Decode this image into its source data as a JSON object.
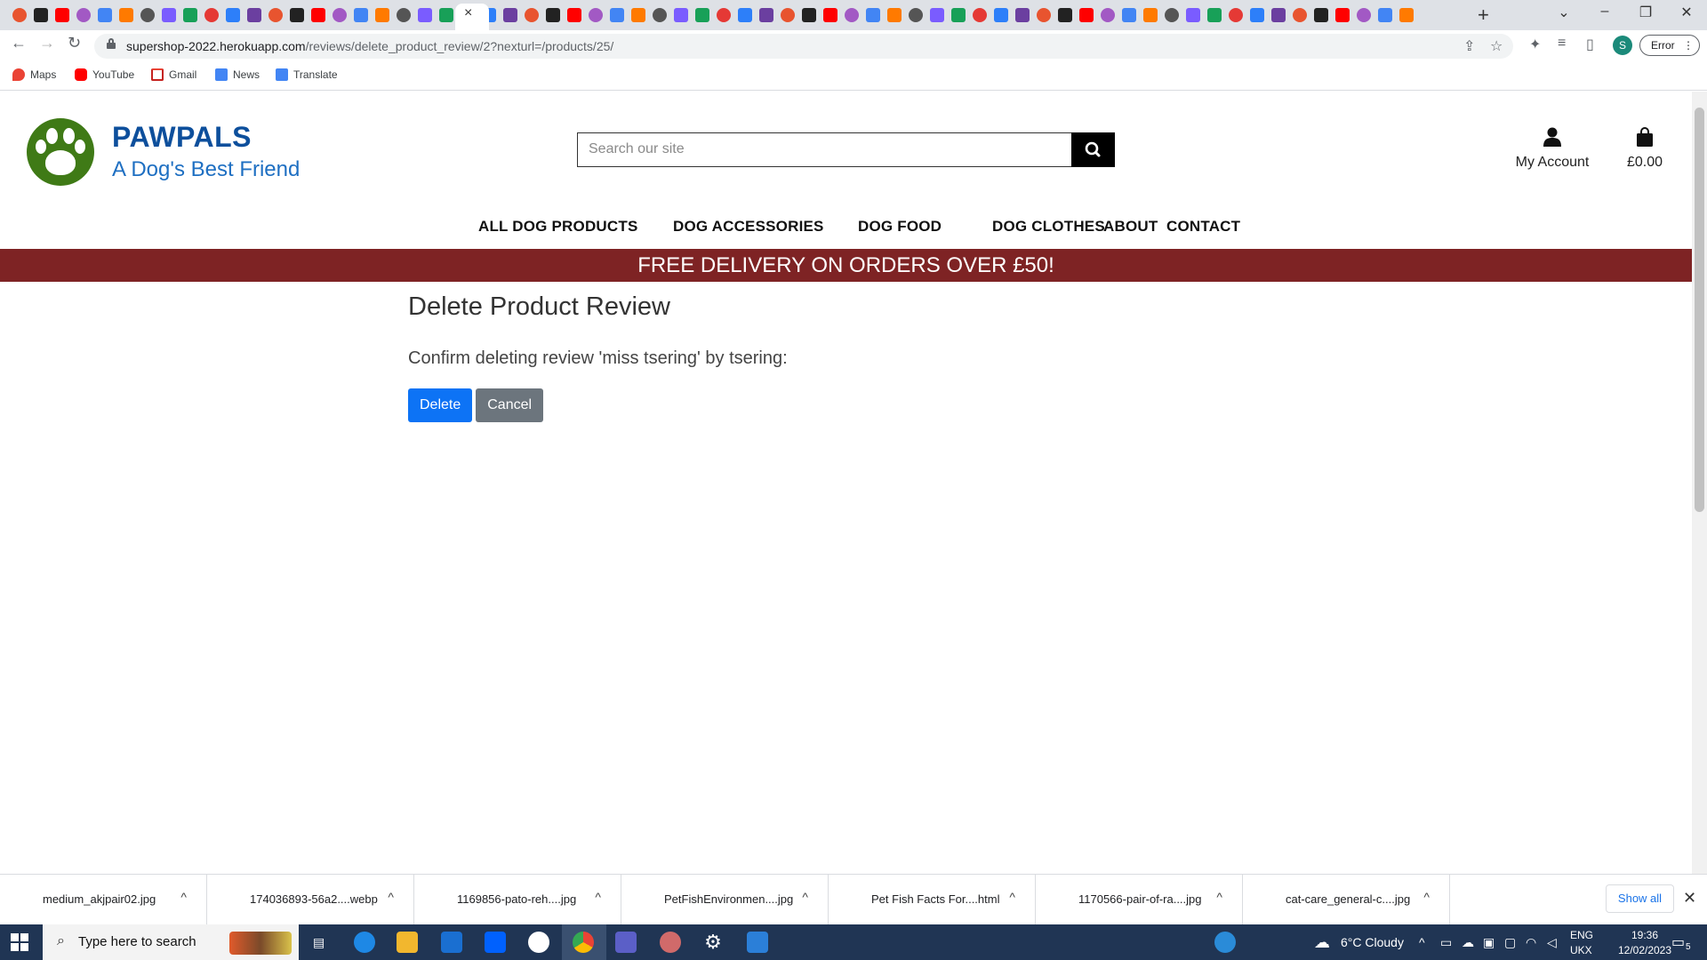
{
  "browser": {
    "url_host": "supershop-2022.herokuapp.com",
    "url_path": "/reviews/delete_product_review/2?nexturl=/products/25/",
    "error_label": "Error",
    "profile_initial": "S",
    "tab_close": "×",
    "new_tab": "+"
  },
  "bookmarks": [
    {
      "label": "Maps",
      "icon": "maps-icon",
      "color": "#ea4335"
    },
    {
      "label": "YouTube",
      "icon": "youtube-icon",
      "color": "#ff0000"
    },
    {
      "label": "Gmail",
      "icon": "gmail-icon",
      "color": "#c5221f"
    },
    {
      "label": "News",
      "icon": "news-icon",
      "color": "#4285f4"
    },
    {
      "label": "Translate",
      "icon": "translate-icon",
      "color": "#4285f4"
    }
  ],
  "site": {
    "brand": "PAWPALS",
    "tagline": "A Dog's Best Friend",
    "search_placeholder": "Search our site",
    "account_label": "My Account",
    "bag_total": "£0.00",
    "nav": [
      "ALL DOG PRODUCTS",
      "DOG ACCESSORIES",
      "DOG FOOD",
      "DOG CLOTHES",
      "ABOUT",
      "CONTACT"
    ],
    "banner": "FREE DELIVERY ON ORDERS OVER £50!",
    "brand_color": "#0d4f9c",
    "banner_color": "#7e2324"
  },
  "page": {
    "title": "Delete Product Review",
    "confirm_text": "Confirm deleting review 'miss tsering' by tsering:",
    "delete_label": "Delete",
    "cancel_label": "Cancel"
  },
  "downloads": {
    "items": [
      "medium_akjpair02.jpg",
      "174036893-56a2....webp",
      "1169856-pato-reh....jpg",
      "PetFishEnvironmen....jpg",
      "Pet Fish Facts For....html",
      "1170566-pair-of-ra....jpg",
      "cat-care_general-c....jpg"
    ],
    "show_all": "Show all"
  },
  "taskbar": {
    "search_text": "Type here to search",
    "weather": "6°C  Cloudy",
    "lang_1": "ENG",
    "lang_2": "UKX",
    "time": "19:36",
    "date": "12/02/2023",
    "notifications": "5"
  }
}
